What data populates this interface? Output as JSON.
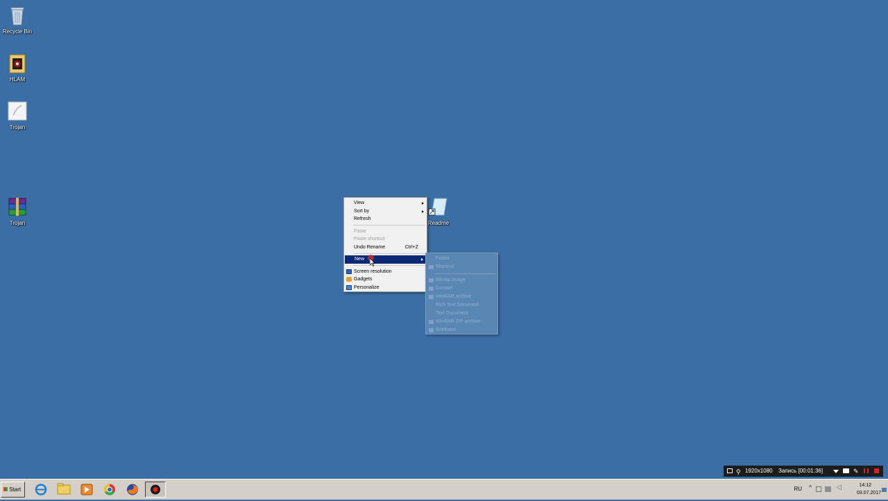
{
  "desktop": {
    "icons": [
      {
        "label": "Recycle Bin",
        "icon": "recycle-bin-icon"
      },
      {
        "label": "HLAM",
        "icon": "folder-icon"
      },
      {
        "label": "Trojan",
        "icon": "application-icon"
      },
      {
        "label": "Trojan",
        "icon": "winrar-archive-icon"
      },
      {
        "label": "Readme",
        "icon": "shortcut-document-icon"
      }
    ]
  },
  "context_menu": {
    "view": "View",
    "sort_by": "Sort by",
    "refresh": "Refresh",
    "paste": "Paste",
    "paste_shortcut": "Paste shortcut",
    "undo_rename": "Undo Rename",
    "undo_shortcut": "Ctrl+Z",
    "new": "New",
    "screen_resolution": "Screen resolution",
    "gadgets": "Gadgets",
    "personalize": "Personalize"
  },
  "new_submenu": {
    "items": [
      "Folder",
      "Shortcut",
      "Bitmap image",
      "Contact",
      "WinRAR archive",
      "Rich Text Document",
      "Text Document",
      "WinRAR ZIP archive",
      "Briefcase"
    ]
  },
  "recorder": {
    "resolution": "1920x1080",
    "status": "Запись [00:01:36]"
  },
  "taskbar": {
    "start_label": "Start",
    "language": "RU",
    "time": "14:12",
    "date": "03.07.2017"
  },
  "colors": {
    "desktop": "#3a6ea5",
    "menu_highlight": "#0b2875",
    "taskbar": "#d4d0c8"
  }
}
